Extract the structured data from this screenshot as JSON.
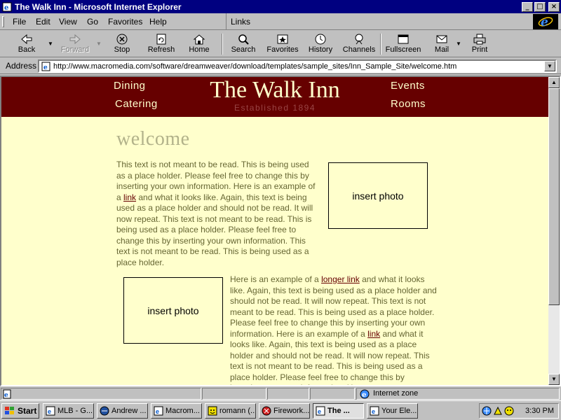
{
  "window": {
    "title": "The Walk Inn - Microsoft Internet Explorer",
    "controls": {
      "minimize": "_",
      "maximize": "□",
      "close": "×"
    }
  },
  "menubar": {
    "items": [
      "File",
      "Edit",
      "View",
      "Go",
      "Favorites",
      "Help"
    ],
    "links_label": "Links"
  },
  "toolbar": {
    "buttons": [
      {
        "label": "Back",
        "icon": "back-arrow-icon",
        "enabled": true
      },
      {
        "label": "Forward",
        "icon": "forward-arrow-icon",
        "enabled": false
      },
      {
        "label": "Stop",
        "icon": "stop-icon",
        "enabled": true
      },
      {
        "label": "Refresh",
        "icon": "refresh-icon",
        "enabled": true
      },
      {
        "label": "Home",
        "icon": "home-icon",
        "enabled": true
      },
      {
        "label": "Search",
        "icon": "search-icon",
        "enabled": true
      },
      {
        "label": "Favorites",
        "icon": "favorites-icon",
        "enabled": true
      },
      {
        "label": "History",
        "icon": "history-icon",
        "enabled": true
      },
      {
        "label": "Channels",
        "icon": "channels-icon",
        "enabled": true
      },
      {
        "label": "Fullscreen",
        "icon": "fullscreen-icon",
        "enabled": true
      },
      {
        "label": "Mail",
        "icon": "mail-icon",
        "enabled": true
      },
      {
        "label": "Print",
        "icon": "print-icon",
        "enabled": true
      }
    ]
  },
  "address": {
    "label": "Address",
    "url": "http://www.macromedia.com/software/dreamweaver/download/templates/sample_sites/Inn_Sample_Site/welcome.htm"
  },
  "site": {
    "title": "The Walk Inn",
    "established": "Established 1894",
    "nav": {
      "dining": "Dining",
      "catering": "Catering",
      "events": "Events",
      "rooms": "Rooms"
    },
    "heading": "welcome",
    "photo_placeholder": "insert photo",
    "para1": {
      "before": "This text is not meant to be read. This is being used as a place holder. Please feel free to change this by inserting your own information. Here is an example of a ",
      "link": "link",
      "after": " and what it looks like. Again, this text is being used as a place holder and should not be read. It will now repeat. This text is not meant to be read. This is being used as a place holder. Please feel free to change this by inserting your own information. This text is not meant to be read. This is being used as a place holder."
    },
    "para2": {
      "before": "Here is an example of a ",
      "link1": "longer link",
      "middle": " and what it looks like. Again, this text is being used as a place holder and should not be read. It will now repeat. This text is not meant to be read. This is being used as a place holder. Please feel free to change this by inserting your own information. Here is an example of a ",
      "link2": "link",
      "after": " and what it looks like. Again, this text is being used as a place holder and should not be read. It will now repeat. This text is not meant to be read. This is being used as a place holder. Please feel free to change this by inserting your own information. Here"
    }
  },
  "statusbar": {
    "zone": "Internet zone"
  },
  "taskbar": {
    "start": "Start",
    "tasks": [
      {
        "label": "MLB - G...",
        "icon": "ie-icon",
        "active": false
      },
      {
        "label": "Andrew ...",
        "icon": "netscape-icon",
        "active": false
      },
      {
        "label": "Macrom...",
        "icon": "ie-icon",
        "active": false
      },
      {
        "label": "romann (...",
        "icon": "messenger-icon",
        "active": false
      },
      {
        "label": "Firework...",
        "icon": "fireworks-icon",
        "active": false
      },
      {
        "label": "The ...",
        "icon": "ie-icon",
        "active": true
      },
      {
        "label": "Your Ele...",
        "icon": "ie-icon",
        "active": false
      }
    ],
    "clock": "3:30 PM"
  },
  "colors": {
    "banner": "#660000",
    "page_background": "#ffffcc",
    "body_text": "#666633",
    "heading": "#b2b28a",
    "link": "#660000",
    "title_bar": "#000080"
  }
}
